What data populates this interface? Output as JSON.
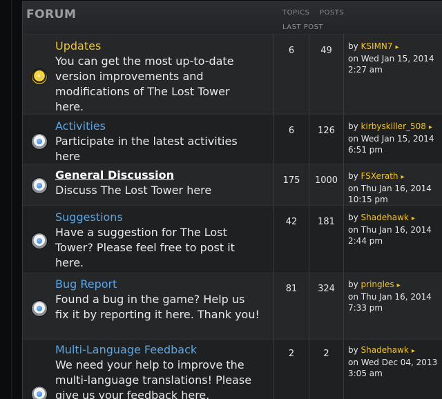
{
  "header": {
    "title": "FORUM",
    "topics_label": "TOPICS",
    "posts_label": "POSTS",
    "last_post_label": "LAST POST"
  },
  "forums": [
    {
      "name": "Updates",
      "description": "You can get the most up-to-date version improvements and modifications of The Lost Tower here.",
      "topics": "6",
      "posts": "49",
      "by": "by",
      "user": "KSIMN7",
      "date": "on Wed Jan 15, 2014",
      "time": "2:27 am"
    },
    {
      "name": "Activities",
      "description": "Participate in the latest activities here",
      "topics": "6",
      "posts": "126",
      "by": "by",
      "user": "kirbyskiller_508",
      "date": "on Wed Jan 15, 2014",
      "time": "6:51 pm"
    },
    {
      "name": "General Discussion",
      "description": "Discuss The Lost Tower here",
      "topics": "175",
      "posts": "1000",
      "by": "by",
      "user": "FSXerath",
      "date": "on Thu Jan 16, 2014",
      "time": "10:15 pm"
    },
    {
      "name": "Suggestions",
      "description": "Have a suggestion for The Lost Tower? Please feel free to post it here.",
      "topics": "42",
      "posts": "181",
      "by": "by",
      "user": "Shadehawk",
      "date": "on Thu Jan 16, 2014",
      "time": "2:44 pm"
    },
    {
      "name": "Bug Report",
      "description": "Found a bug in the game? Help us fix it by reporting it here. Thank you!",
      "topics": "81",
      "posts": "324",
      "by": "by",
      "user": "pringles",
      "date": "on Thu Jan 16, 2014",
      "time": "7:33 pm"
    },
    {
      "name": "Multi-Language Feedback",
      "description": "We need your help to improve the multi-language translations! Please give us your feedback here.",
      "topics": "2",
      "posts": "2",
      "by": "by",
      "user": "Shadehawk",
      "date": "on Wed Dec 04, 2013",
      "time": "3:05 am"
    }
  ],
  "colors": {
    "accent_gold": "#f2c429",
    "link_blue": "#5aa6e6",
    "row_bg": "#262729",
    "row_bg_alt": "#1f2022"
  },
  "icons": {
    "new_posts": "forum-unread-icon",
    "read": "forum-read-icon",
    "goto_last_post": "arrow-right-icon"
  }
}
